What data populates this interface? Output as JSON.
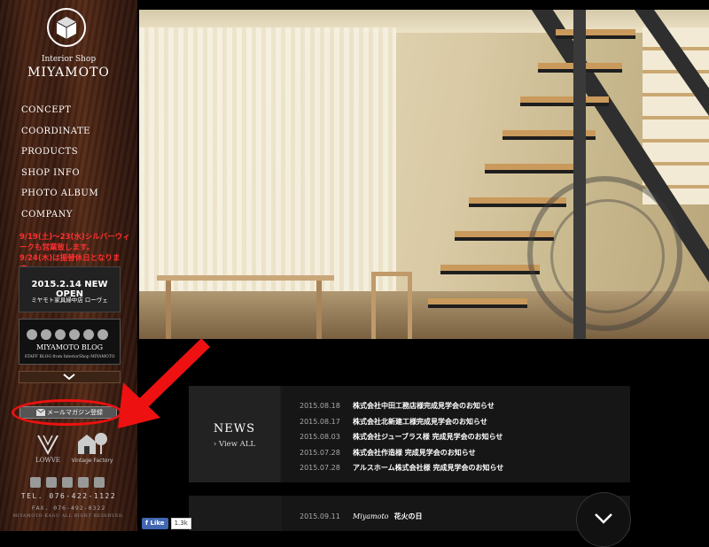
{
  "brand": {
    "sub": "Interior Shop",
    "name": "MIYAMOTO"
  },
  "nav": [
    {
      "label": "CONCEPT"
    },
    {
      "label": "COORDINATE"
    },
    {
      "label": "PRODUCTS"
    },
    {
      "label": "SHOP INFO"
    },
    {
      "label": "PHOTO ALBUM"
    },
    {
      "label": "COMPANY"
    }
  ],
  "notice": [
    "9/19(土)〜23(水)シルバーウィークも営業致します。",
    "9/24(木)は振替休日となります。"
  ],
  "banners": {
    "open_title": "2015.2.14 NEW OPEN",
    "open_sub": "ミヤモト家具婦中店 ローヴェ",
    "blog_title": "MIYAMOTO BLOG",
    "blog_sub": "STAFF BLOG from InteriorShop MIYAMOTO"
  },
  "mail_button": "メールマガジン登録",
  "partners": {
    "lowve": "LOWVE",
    "vintage": "Vintage Factory"
  },
  "social_icons": [
    "facebook-icon",
    "twitter-icon",
    "instagram-icon",
    "wordpress-icon",
    "youtube-icon"
  ],
  "contact": {
    "tel": "TEL. 076-422-1122",
    "fax": "FAX. 076-492-0322",
    "copyright": "MIYAMOTO-KAGU ALL RIGHT RESERVED."
  },
  "news": {
    "heading": "NEWS",
    "view_all": "View ALL",
    "items": [
      {
        "date": "2015.08.18",
        "title": "株式会社中田工務店様完成見学会のお知らせ"
      },
      {
        "date": "2015.08.17",
        "title": "株式会社北新建工様完成見学会のお知らせ"
      },
      {
        "date": "2015.08.03",
        "title": "株式会社ジューブラス様 完成見学会のお知らせ"
      },
      {
        "date": "2015.07.28",
        "title": "株式会社作造様 完成見学会のお知らせ"
      },
      {
        "date": "2015.07.28",
        "title": "アルスホーム株式会社様 完成見学会のお知らせ"
      }
    ]
  },
  "blog": {
    "items": [
      {
        "date": "2015.09.11",
        "category": "Miyamoto",
        "title": "花火の日"
      }
    ]
  },
  "facebook": {
    "like": "Like",
    "count": "1.3k"
  },
  "colors": {
    "notice_red": "#ff3030",
    "annotation_red": "#ee1111",
    "fb_blue": "#4267b2"
  }
}
